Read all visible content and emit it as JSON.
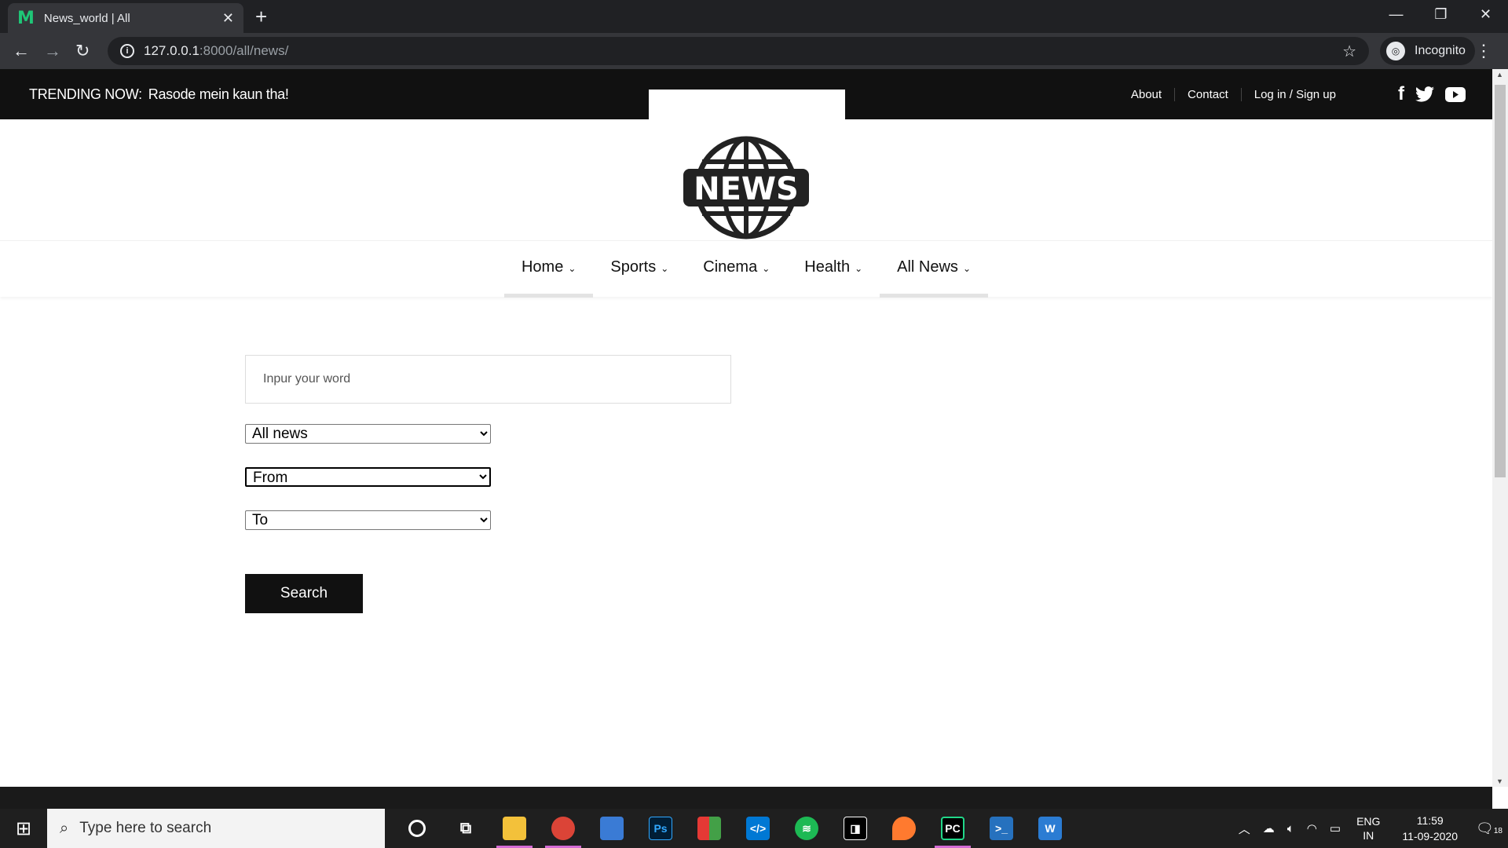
{
  "browser": {
    "tab_title": "News_world | All",
    "tab_favicon": "M",
    "url_host": "127.0.0.1",
    "url_path": ":8000/all/news/",
    "profile_label": "Incognito"
  },
  "site": {
    "trending_label": "TRENDING NOW:",
    "trending_text": "Rasode mein kaun tha!",
    "top_links": [
      "About",
      "Contact",
      "Log in / Sign up"
    ],
    "social_icons": [
      "facebook-icon",
      "twitter-icon",
      "youtube-icon"
    ],
    "logo_text": "NEWS",
    "nav": [
      {
        "label": "Home",
        "active": true
      },
      {
        "label": "Sports",
        "active": false
      },
      {
        "label": "Cinema",
        "active": false
      },
      {
        "label": "Health",
        "active": false
      },
      {
        "label": "All News",
        "active": true
      }
    ]
  },
  "form": {
    "word_placeholder": "Inpur your word",
    "category_value": "All news",
    "from_value": "From",
    "to_value": "To",
    "search_label": "Search"
  },
  "taskbar": {
    "search_placeholder": "Type here to search",
    "lang_top": "ENG",
    "lang_bottom": "IN",
    "time": "11:59",
    "date": "11-09-2020",
    "notification_count": "18"
  }
}
